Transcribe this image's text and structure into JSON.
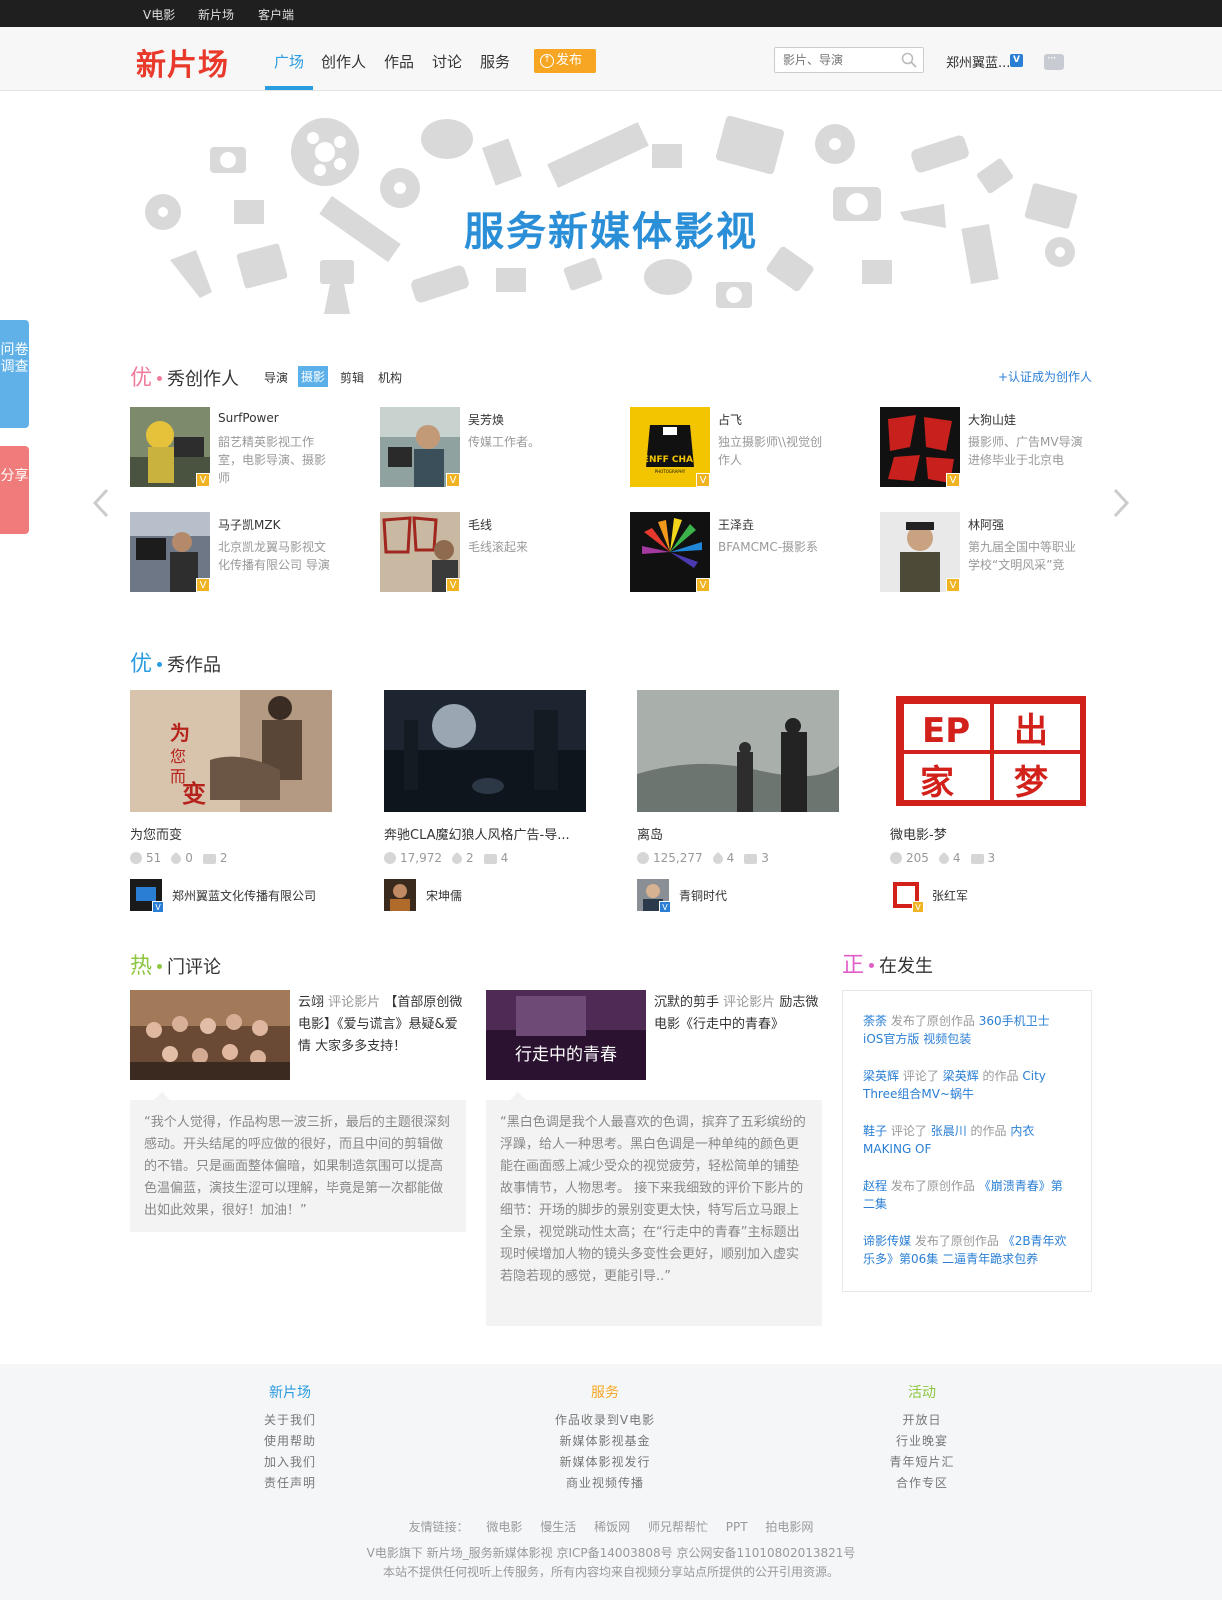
{
  "topbar": {
    "links": [
      "V电影",
      "新片场",
      "客户端"
    ]
  },
  "header": {
    "logo": "新片场",
    "nav": [
      "广场",
      "创作人",
      "作品",
      "讨论",
      "服务"
    ],
    "publish": "发布",
    "search_placeholder": "影片、导演",
    "user": "郑州翼蓝...",
    "verified": "V"
  },
  "banner": {
    "title": "服务新媒体影视"
  },
  "side": {
    "survey": "问卷调查",
    "share": "分享"
  },
  "creators_section": {
    "title_first": "优",
    "title_rest": "秀创作人",
    "tabs": [
      "导演",
      "摄影",
      "剪辑",
      "机构"
    ],
    "active_tab": "摄影",
    "certify": "+认证成为创作人",
    "items": [
      {
        "name": "SurfPower",
        "desc": "韶艺精英影视工作室，电影导演、摄影师"
      },
      {
        "name": "吴芳焕",
        "desc": "传媒工作者。"
      },
      {
        "name": "占飞",
        "desc": "独立摄影师\\\\视觉创作人"
      },
      {
        "name": "大狗山娃",
        "desc": "摄影师、广告MV导演 进修毕业于北京电"
      },
      {
        "name": "马子凯MZK",
        "desc": "北京凯龙翼马影视文化传播有限公司 导演"
      },
      {
        "name": "毛线",
        "desc": "毛线滚起来"
      },
      {
        "name": "王泽垚",
        "desc": "BFAMCMC-摄影系"
      },
      {
        "name": "林阿强",
        "desc": "第九届全国中等职业学校“文明风采”竞"
      }
    ]
  },
  "works_section": {
    "title_first": "优",
    "title_rest": "秀作品",
    "items": [
      {
        "title": "为您而变",
        "plays": "51",
        "likes": "0",
        "comments": "2",
        "author": "郑州翼蓝文化传播有限公司"
      },
      {
        "title": "奔驰CLA魔幻狼人风格广告-导...",
        "plays": "17,972",
        "likes": "2",
        "comments": "4",
        "author": "宋坤儒"
      },
      {
        "title": "离岛",
        "plays": "125,277",
        "likes": "4",
        "comments": "3",
        "author": "青铜时代"
      },
      {
        "title": "微电影-梦",
        "plays": "205",
        "likes": "4",
        "comments": "3",
        "author": "张红军"
      }
    ]
  },
  "comments_section": {
    "title_first": "热",
    "title_rest": "门评论",
    "items": [
      {
        "user": "云翊",
        "action": "评论影片",
        "film": "【首部原创微电影】《爱与谎言》悬疑&爱情 大家多多支持！",
        "quote": "“我个人觉得，作品构思一波三折，最后的主题很深刻感动。开头结尾的呼应做的很好，而且中间的剪辑做的不错。只是画面整体偏暗，如果制造氛围可以提高色温偏蓝，演技生涩可以理解，毕竟是第一次都能做出如此效果，很好！加油！”"
      },
      {
        "user": "沉默的剪手",
        "action": "评论影片",
        "film": "励志微电影《行走中的青春》",
        "poster_text": "行走中的青春",
        "quote": "“黑白色调是我个人最喜欢的色调，摈弃了五彩缤纷的浮躁，给人一种思考。黑白色调是一种单纯的颜色更能在画面感上减少受众的视觉疲劳，轻松简单的铺垫故事情节，人物思考。 接下来我细致的评价下影片的细节：开场的脚步的景别变更太快，特写后立马跟上全景，视觉跳动性太高；在“行走中的青春”主标题出现时候增加人物的镜头多变性会更好，顺别加入虚实若隐若现的感觉，更能引导..”"
      }
    ]
  },
  "happening_section": {
    "title_first": "正",
    "title_rest": "在发生",
    "items": [
      {
        "user": "荼荼",
        "action": "发布了原创作品",
        "target": "360手机卫士 iOS官方版 视频包装"
      },
      {
        "user": "梁英辉",
        "action": "评论了",
        "target": "梁英辉",
        "mid": "的作品",
        "target2": "City Three组合MV~蜗牛"
      },
      {
        "user": "鞋子",
        "action": "评论了",
        "target": "张晨川",
        "mid": "的作品",
        "target2": "内衣 MAKING OF"
      },
      {
        "user": "赵程",
        "action": "发布了原创作品",
        "target": "《崩溃青春》第二集"
      },
      {
        "user": "谛影传媒",
        "action": "发布了原创作品",
        "target": "《2B青年欢乐多》第06集 二逼青年跪求包养"
      }
    ]
  },
  "footer": {
    "cols": [
      {
        "title": "新片场",
        "color": "#2a9ce0",
        "links": [
          "关于我们",
          "使用帮助",
          "加入我们",
          "责任声明"
        ]
      },
      {
        "title": "服务",
        "color": "#f6a623",
        "links": [
          "作品收录到V电影",
          "新媒体影视基金",
          "新媒体影视发行",
          "商业视频传播"
        ]
      },
      {
        "title": "活动",
        "color": "#8cc63f",
        "links": [
          "开放日",
          "行业晚宴",
          "青年短片汇",
          "合作专区"
        ]
      }
    ],
    "friends_label": "友情链接：",
    "friends": [
      "微电影",
      "慢生活",
      "稀饭网",
      "师兄帮帮忙",
      "PPT",
      "拍电影网"
    ],
    "copy1": "V电影旗下 新片场_服务新媒体影视   京ICP备14003808号   京公网安备11010802013821号",
    "copy2": "本站不提供任何视听上传服务，所有内容均来自视频分享站点所提供的公开引用资源。"
  },
  "colors": {
    "accent": "#2a9ce0",
    "logo": "#e8392b",
    "publish": "#f6a623",
    "sec_creators": "#f07b9b",
    "sec_works": "#2a9ce0",
    "sec_comments": "#8cc63f",
    "sec_happening": "#e05ec8"
  }
}
